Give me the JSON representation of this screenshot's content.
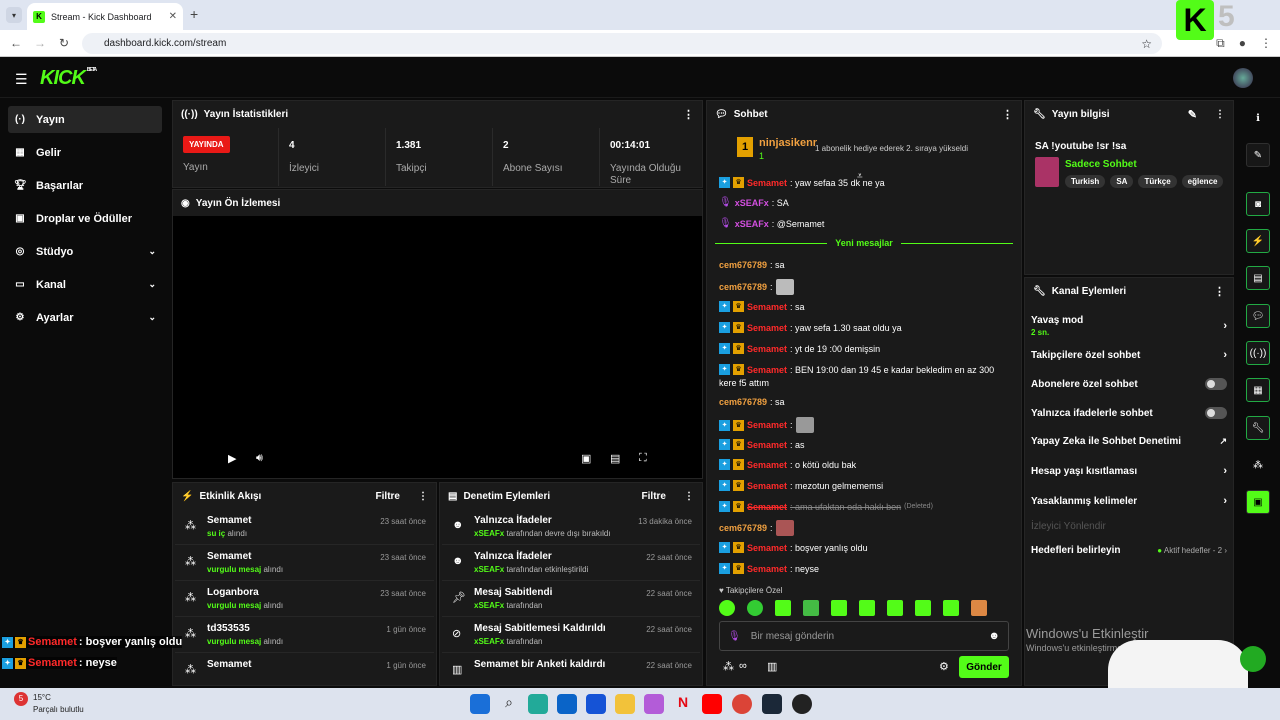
{
  "browser": {
    "tab_title": "Stream - Kick Dashboard",
    "url": "dashboard.kick.com/stream",
    "overlay_number": "5"
  },
  "header": {
    "logo": "KICK",
    "beta": "BETA"
  },
  "sidebar": {
    "items": [
      {
        "label": "Yayın",
        "icon": "broadcast-icon"
      },
      {
        "label": "Gelir",
        "icon": "revenue-icon"
      },
      {
        "label": "Başarılar",
        "icon": "trophy-icon"
      },
      {
        "label": "Droplar ve Ödüller",
        "icon": "gift-icon"
      },
      {
        "label": "Stüdyo",
        "icon": "studio-icon"
      },
      {
        "label": "Kanal",
        "icon": "channel-icon"
      },
      {
        "label": "Ayarlar",
        "icon": "gear-icon"
      }
    ]
  },
  "stats": {
    "title": "Yayın İstatistikleri",
    "live_badge": "YAYINDA",
    "live_label": "Yayın",
    "viewers": "4",
    "viewers_label": "İzleyici",
    "followers": "1.381",
    "followers_label": "Takipçi",
    "subs": "2",
    "subs_label": "Abone Sayısı",
    "duration": "00:14:01",
    "duration_label": "Yayında Olduğu Süre"
  },
  "preview": {
    "title": "Yayın Ön İzlemesi"
  },
  "activity": {
    "title": "Etkinlik Akışı",
    "filter": "Filtre",
    "rows": [
      {
        "name": "Semamet",
        "hl": "su iç",
        "rest": "alındı",
        "time": "23 saat önce"
      },
      {
        "name": "Semamet",
        "hl": "vurgulu mesaj",
        "rest": "alındı",
        "time": "23 saat önce"
      },
      {
        "name": "Loganbora",
        "hl": "vurgulu mesaj",
        "rest": "alındı",
        "time": "23 saat önce"
      },
      {
        "name": "td353535",
        "hl": "vurgulu mesaj",
        "rest": "alındı",
        "time": "1 gün önce"
      },
      {
        "name": "Semamet",
        "hl": "",
        "rest": "",
        "time": "1 gün önce"
      }
    ]
  },
  "moderation": {
    "title": "Denetim Eylemleri",
    "filter": "Filtre",
    "rows": [
      {
        "t1": "Yalnızca İfadeler",
        "hl": "xSEAFx",
        "rest": "tarafından devre dışı bırakıldı",
        "time": "13 dakika önce"
      },
      {
        "t1": "Yalnızca İfadeler",
        "hl": "xSEAFx",
        "rest": "tarafından etkinleştirildi",
        "time": "22 saat önce"
      },
      {
        "t1": "Mesaj Sabitlendi",
        "hl": "xSEAFx",
        "rest": "tarafından",
        "time": "22 saat önce"
      },
      {
        "t1": "Mesaj Sabitlemesi Kaldırıldı",
        "hl": "xSEAFx",
        "rest": "tarafından",
        "time": "22 saat önce"
      },
      {
        "t1": "Semamet bir Anketi kaldırdı",
        "hl": "",
        "rest": "",
        "time": "22 saat önce"
      }
    ]
  },
  "chat": {
    "title": "Sohbet",
    "pinned_user": "ninjasikenr",
    "pinned_count": "1",
    "pinned_msg": "1 abonelik hediye ederek 2. sıraya yükseldi",
    "new_messages": "Yeni mesajlar",
    "messages": [
      {
        "user": "Semamet",
        "text": ": yaw sefaa 35 dk ne ya",
        "style": "red"
      },
      {
        "user": "xSEAFx",
        "text": ": SA",
        "style": "pur"
      },
      {
        "user": "xSEAFx",
        "text": ": @Semamet",
        "style": "pur"
      },
      {
        "user": "cem676789",
        "text": ": sa",
        "style": "ora"
      },
      {
        "user": "cem676789",
        "text": ":",
        "style": "ora"
      },
      {
        "user": "Semamet",
        "text": ": sa",
        "style": "red"
      },
      {
        "user": "Semamet",
        "text": ": yaw sefa 1.30 saat oldu ya",
        "style": "red"
      },
      {
        "user": "Semamet",
        "text": ": yt de 19 :00 demişsin",
        "style": "red"
      },
      {
        "user": "Semamet",
        "text": ": BEN 19:00 dan 19 45 e kadar bekledim en az 300",
        "style": "red"
      },
      {
        "user": "",
        "text": "kere f5 attım",
        "style": "cont"
      },
      {
        "user": "cem676789",
        "text": ": sa",
        "style": "ora"
      },
      {
        "user": "Semamet",
        "text": ":",
        "style": "red"
      },
      {
        "user": "Semamet",
        "text": ": as",
        "style": "red"
      },
      {
        "user": "Semamet",
        "text": ": o kötü oldu bak",
        "style": "red"
      },
      {
        "user": "Semamet",
        "text": ": mezotun gelmememsi",
        "style": "red"
      },
      {
        "user": "Semamet",
        "text": ": ama ufaktan oda haklı ben",
        "style": "red"
      },
      {
        "user": "cem676789",
        "text": ":",
        "style": "ora"
      },
      {
        "user": "Semamet",
        "text": ": boşver yanlış oldu",
        "style": "red"
      },
      {
        "user": "Semamet",
        "text": ": neyse",
        "style": "red"
      }
    ],
    "deleted": "(Deleted)",
    "followers_only": "Takipçilere Özel",
    "placeholder": "Bir mesaj gönderin",
    "send": "Gönder"
  },
  "stream_info": {
    "title": "Yayın bilgisi",
    "stream_title": "SA !youtube !sr !sa",
    "category": "Sadece Sohbet",
    "tags": [
      "Turkish",
      "SA",
      "Türkçe",
      "eğlence"
    ]
  },
  "channel_actions": {
    "title": "Kanal Eylemleri",
    "slow_mode": "Yavaş mod",
    "slow_value": "2 sn.",
    "followers_chat": "Takipçilere özel sohbet",
    "subs_chat": "Abonelere özel sohbet",
    "emote_chat": "Yalnızca ifadelerle sohbet",
    "ai_mod": "Yapay Zeka ile Sohbet Denetimi",
    "age_limit": "Hesap yaşı kısıtlaması",
    "banned_words": "Yasaklanmış kelimeler",
    "host": "İzleyici Yönlendir",
    "goals": "Hedefleri belirleyin",
    "goals_active": "Aktif hedefler - 2"
  },
  "windows": {
    "activate": "Windows'u Etkinleştir",
    "activate_sub": "Windows'u etkinleştirmek için",
    "weather_temp": "15°C",
    "weather_desc": "Parçalı bulutlu",
    "weather_badge": "5"
  },
  "overlay_chat": [
    {
      "user": "Semamet",
      "text": ": boşver yanlış oldu"
    },
    {
      "user": "Semamet",
      "text": ": neyse"
    }
  ],
  "colors": {
    "kick_green": "#53fc18",
    "live_red": "#e91916",
    "panel": "#1a1a1a"
  }
}
